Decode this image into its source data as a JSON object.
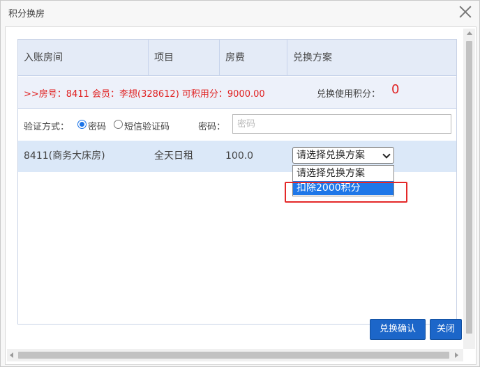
{
  "window": {
    "title": "积分换房"
  },
  "table": {
    "columns": [
      "入账房间",
      "项目",
      "房费",
      "兑换方案"
    ]
  },
  "member_info": {
    "summary": ">>房号：8411   会员：李想(328612)   可积用分：9000.00",
    "points_used_label": "兑换使用积分：",
    "points_used_value": "0"
  },
  "verify": {
    "label": "验证方式：",
    "options": [
      "密码",
      "短信验证码"
    ],
    "selected": "密码",
    "password_label": "密码：",
    "password_placeholder": "密码",
    "password_value": ""
  },
  "row": {
    "room": "8411(商务大床房)",
    "item": "全天日租",
    "fee": "100.0",
    "plan_selected": "请选择兑换方案"
  },
  "dropdown": {
    "options": [
      "请选择兑换方案",
      "扣除2000积分"
    ],
    "highlighted": "扣除2000积分"
  },
  "buttons": {
    "confirm": "兑换确认",
    "close": "关闭"
  },
  "colors": {
    "accent": "#1c66c9",
    "alert_red": "#e02020",
    "header_bg": "#e4ebf7",
    "row_bg": "#dbe8f8"
  }
}
